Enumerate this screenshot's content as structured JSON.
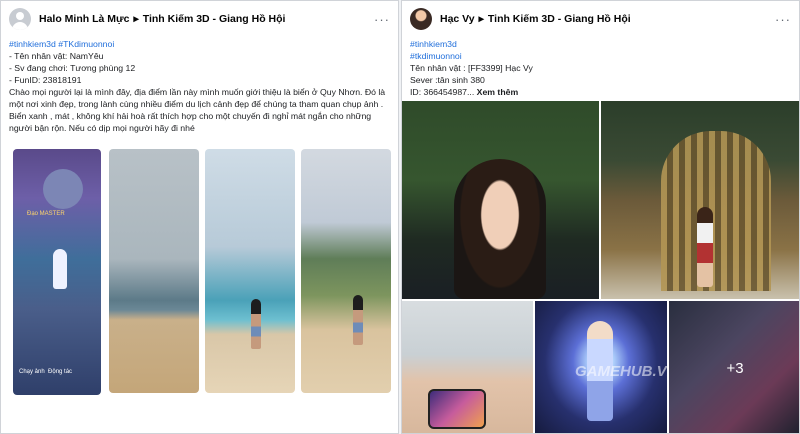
{
  "left_post": {
    "author": "Halo Minh Là Mực",
    "separator": "▸",
    "group": "Tinh Kiếm 3D - Giang Hồ Hội",
    "more": "···",
    "hashtags": "#tinhkiem3d #TKdimuonnoi",
    "lines": [
      "- Tên nhân vật: NamYêu",
      "- Sv đang chơi: Tương phùng 12",
      "- FunID: 23818191"
    ],
    "message": "Chào mọi người lại là mình đây, địa điểm lần này mình muốn giới thiệu là biển ở Quy Nhơn. Đó là một nơi xinh đẹp, trong lành cùng nhiều điểm du lịch cảnh đẹp để chúng ta tham quan chụp ảnh . Biển xanh , mát , không khí hải hoà rất thích hợp cho một chuyến đi nghỉ mát ngắn cho những người bận rộn. Nếu có dịp mọi người hãy đi nhé",
    "game_shot": {
      "name_label": "Đạo MASTER",
      "chat_label": "Chạy ảnh",
      "action_label": "Động tác"
    }
  },
  "right_post": {
    "author": "Hạc Vy",
    "separator": "▸",
    "group": "Tinh Kiếm 3D - Giang Hồ Hội",
    "more": "···",
    "hashtag1": "#tinhkiem3d",
    "hashtag2": "#tkdimuonnoi",
    "line_name": "Tên nhân vật : [FF3399] Hạc Vy",
    "line_server": "Sever :tân sinh 380",
    "line_id": "ID: 366454987...",
    "see_more": "Xem thêm",
    "watermark": "GAMEHUB.VN",
    "more_photos": "+3"
  }
}
